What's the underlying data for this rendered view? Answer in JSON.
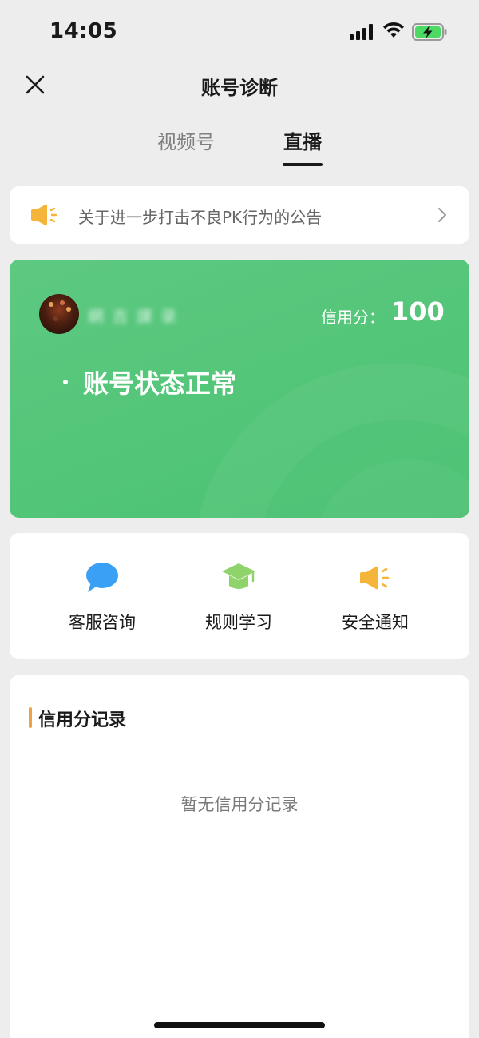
{
  "status_bar": {
    "time": "14:05",
    "icons": [
      "signal-icon",
      "wifi-icon",
      "battery-charging-icon"
    ]
  },
  "nav": {
    "title": "账号诊断",
    "close_icon": "close-icon"
  },
  "tabs": [
    {
      "label": "视频号",
      "active": false
    },
    {
      "label": "直播",
      "active": true
    }
  ],
  "notice": {
    "icon": "megaphone-icon",
    "text": "关于进一步打击不良PK行为的公告",
    "arrow_icon": "chevron-right-icon"
  },
  "account_card": {
    "username": "網 吉 課 录",
    "credit_label": "信用分：",
    "credit_value": "100",
    "status_text": "账号状态正常",
    "colors": {
      "card": "#52c578"
    }
  },
  "shortcuts": [
    {
      "label": "客服咨询",
      "icon": "chat-bubble-icon",
      "color": "#3aa0f5"
    },
    {
      "label": "规则学习",
      "icon": "graduation-cap-icon",
      "color": "#8fd46a"
    },
    {
      "label": "安全通知",
      "icon": "megaphone-icon",
      "color": "#f5b53a"
    }
  ],
  "records": {
    "title": "信用分记录",
    "empty_text": "暂无信用分记录",
    "accent_color": "#f0a145"
  }
}
